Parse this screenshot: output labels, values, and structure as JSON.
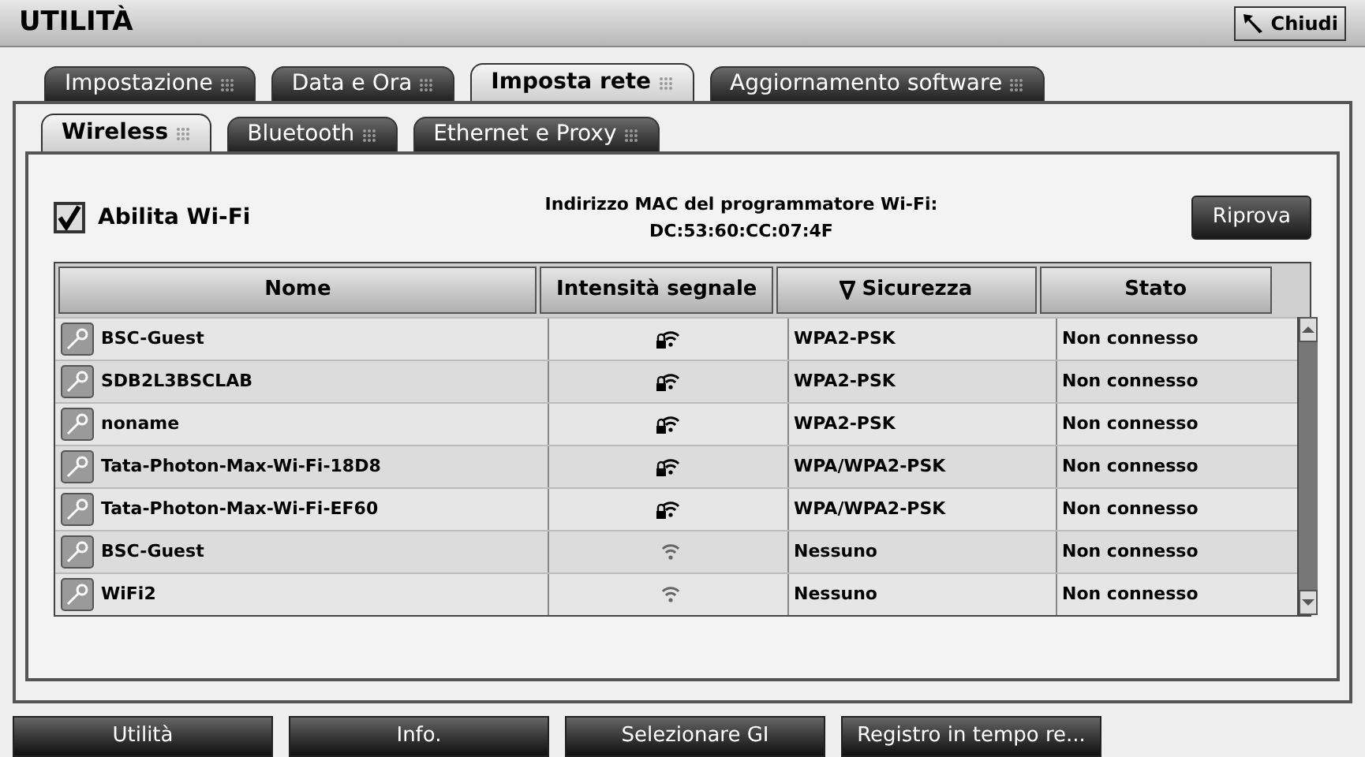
{
  "window": {
    "title": "UTILITÀ",
    "close_button": "Chiudi"
  },
  "tabs": [
    {
      "label": "Impostazione",
      "selected": false
    },
    {
      "label": "Data e Ora",
      "selected": false
    },
    {
      "label": "Imposta rete",
      "selected": true
    },
    {
      "label": "Aggiornamento software",
      "selected": false
    }
  ],
  "subtabs": [
    {
      "label": "Wireless",
      "selected": true
    },
    {
      "label": "Bluetooth",
      "selected": false
    },
    {
      "label": "Ethernet e Proxy",
      "selected": false
    }
  ],
  "wifi": {
    "label": "Abilita Wi-Fi",
    "checked": true
  },
  "mac": {
    "label": "Indirizzo MAC del programmatore Wi-Fi:",
    "value": "DC:53:60:CC:07:4F"
  },
  "retry_button": "Riprova",
  "table": {
    "columns": [
      {
        "label": "Nome",
        "sorted": false
      },
      {
        "label": "Intensità segnale",
        "sorted": false
      },
      {
        "label": "Sicurezza",
        "sorted": true
      },
      {
        "label": "Stato",
        "sorted": false
      }
    ],
    "rows": [
      {
        "name": "BSC-Guest",
        "locked": true,
        "security": "WPA2-PSK",
        "status": "Non connesso"
      },
      {
        "name": "SDB2L3BSCLAB",
        "locked": true,
        "security": "WPA2-PSK",
        "status": "Non connesso"
      },
      {
        "name": "noname",
        "locked": true,
        "security": "WPA2-PSK",
        "status": "Non connesso"
      },
      {
        "name": "Tata-Photon-Max-Wi-Fi-18D8",
        "locked": true,
        "security": "WPA/WPA2-PSK",
        "status": "Non connesso"
      },
      {
        "name": "Tata-Photon-Max-Wi-Fi-EF60",
        "locked": true,
        "security": "WPA/WPA2-PSK",
        "status": "Non connesso"
      },
      {
        "name": "BSC-Guest",
        "locked": false,
        "security": "Nessuno",
        "status": "Non connesso"
      },
      {
        "name": "WiFi2",
        "locked": false,
        "security": "Nessuno",
        "status": "Non connesso"
      }
    ]
  },
  "nav": [
    {
      "label": "Utilità"
    },
    {
      "label": "Info."
    },
    {
      "label": "Selezionare GI"
    },
    {
      "label": "Registro in tempo re..."
    }
  ]
}
